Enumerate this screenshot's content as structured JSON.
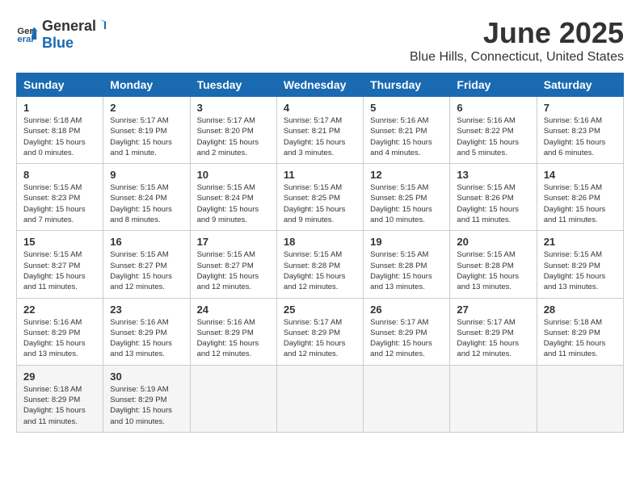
{
  "logo": {
    "general": "General",
    "blue": "Blue"
  },
  "header": {
    "month": "June 2025",
    "location": "Blue Hills, Connecticut, United States"
  },
  "weekdays": [
    "Sunday",
    "Monday",
    "Tuesday",
    "Wednesday",
    "Thursday",
    "Friday",
    "Saturday"
  ],
  "weeks": [
    [
      {
        "day": "1",
        "sunrise": "5:18 AM",
        "sunset": "8:18 PM",
        "daylight": "15 hours and 0 minutes."
      },
      {
        "day": "2",
        "sunrise": "5:17 AM",
        "sunset": "8:19 PM",
        "daylight": "15 hours and 1 minute."
      },
      {
        "day": "3",
        "sunrise": "5:17 AM",
        "sunset": "8:20 PM",
        "daylight": "15 hours and 2 minutes."
      },
      {
        "day": "4",
        "sunrise": "5:17 AM",
        "sunset": "8:21 PM",
        "daylight": "15 hours and 3 minutes."
      },
      {
        "day": "5",
        "sunrise": "5:16 AM",
        "sunset": "8:21 PM",
        "daylight": "15 hours and 4 minutes."
      },
      {
        "day": "6",
        "sunrise": "5:16 AM",
        "sunset": "8:22 PM",
        "daylight": "15 hours and 5 minutes."
      },
      {
        "day": "7",
        "sunrise": "5:16 AM",
        "sunset": "8:23 PM",
        "daylight": "15 hours and 6 minutes."
      }
    ],
    [
      {
        "day": "8",
        "sunrise": "5:15 AM",
        "sunset": "8:23 PM",
        "daylight": "15 hours and 7 minutes."
      },
      {
        "day": "9",
        "sunrise": "5:15 AM",
        "sunset": "8:24 PM",
        "daylight": "15 hours and 8 minutes."
      },
      {
        "day": "10",
        "sunrise": "5:15 AM",
        "sunset": "8:24 PM",
        "daylight": "15 hours and 9 minutes."
      },
      {
        "day": "11",
        "sunrise": "5:15 AM",
        "sunset": "8:25 PM",
        "daylight": "15 hours and 9 minutes."
      },
      {
        "day": "12",
        "sunrise": "5:15 AM",
        "sunset": "8:25 PM",
        "daylight": "15 hours and 10 minutes."
      },
      {
        "day": "13",
        "sunrise": "5:15 AM",
        "sunset": "8:26 PM",
        "daylight": "15 hours and 11 minutes."
      },
      {
        "day": "14",
        "sunrise": "5:15 AM",
        "sunset": "8:26 PM",
        "daylight": "15 hours and 11 minutes."
      }
    ],
    [
      {
        "day": "15",
        "sunrise": "5:15 AM",
        "sunset": "8:27 PM",
        "daylight": "15 hours and 11 minutes."
      },
      {
        "day": "16",
        "sunrise": "5:15 AM",
        "sunset": "8:27 PM",
        "daylight": "15 hours and 12 minutes."
      },
      {
        "day": "17",
        "sunrise": "5:15 AM",
        "sunset": "8:27 PM",
        "daylight": "15 hours and 12 minutes."
      },
      {
        "day": "18",
        "sunrise": "5:15 AM",
        "sunset": "8:28 PM",
        "daylight": "15 hours and 12 minutes."
      },
      {
        "day": "19",
        "sunrise": "5:15 AM",
        "sunset": "8:28 PM",
        "daylight": "15 hours and 13 minutes."
      },
      {
        "day": "20",
        "sunrise": "5:15 AM",
        "sunset": "8:28 PM",
        "daylight": "15 hours and 13 minutes."
      },
      {
        "day": "21",
        "sunrise": "5:15 AM",
        "sunset": "8:29 PM",
        "daylight": "15 hours and 13 minutes."
      }
    ],
    [
      {
        "day": "22",
        "sunrise": "5:16 AM",
        "sunset": "8:29 PM",
        "daylight": "15 hours and 13 minutes."
      },
      {
        "day": "23",
        "sunrise": "5:16 AM",
        "sunset": "8:29 PM",
        "daylight": "15 hours and 13 minutes."
      },
      {
        "day": "24",
        "sunrise": "5:16 AM",
        "sunset": "8:29 PM",
        "daylight": "15 hours and 12 minutes."
      },
      {
        "day": "25",
        "sunrise": "5:17 AM",
        "sunset": "8:29 PM",
        "daylight": "15 hours and 12 minutes."
      },
      {
        "day": "26",
        "sunrise": "5:17 AM",
        "sunset": "8:29 PM",
        "daylight": "15 hours and 12 minutes."
      },
      {
        "day": "27",
        "sunrise": "5:17 AM",
        "sunset": "8:29 PM",
        "daylight": "15 hours and 12 minutes."
      },
      {
        "day": "28",
        "sunrise": "5:18 AM",
        "sunset": "8:29 PM",
        "daylight": "15 hours and 11 minutes."
      }
    ],
    [
      {
        "day": "29",
        "sunrise": "5:18 AM",
        "sunset": "8:29 PM",
        "daylight": "15 hours and 11 minutes."
      },
      {
        "day": "30",
        "sunrise": "5:19 AM",
        "sunset": "8:29 PM",
        "daylight": "15 hours and 10 minutes."
      },
      null,
      null,
      null,
      null,
      null
    ]
  ]
}
